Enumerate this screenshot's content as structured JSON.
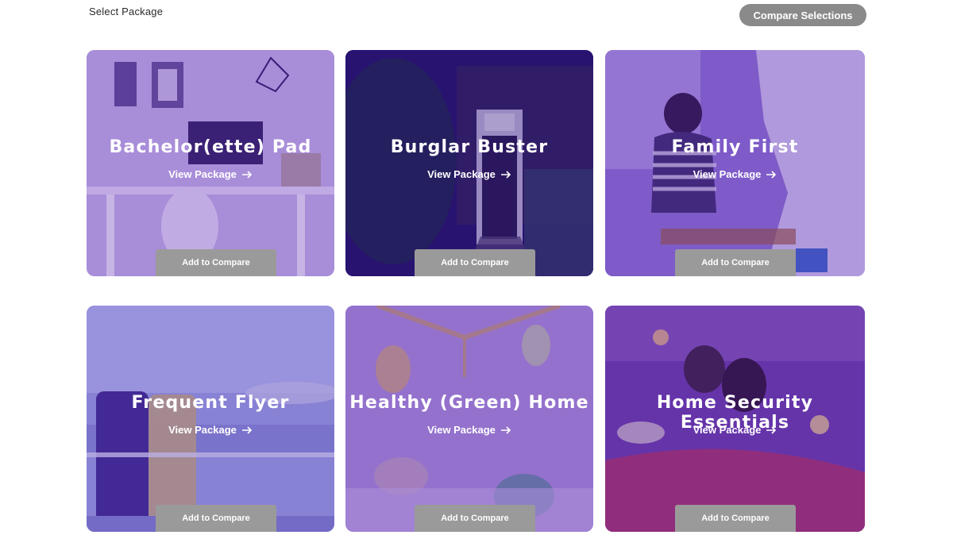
{
  "header": {
    "title": "Select Package",
    "compare_label": "Compare Selections"
  },
  "packages": [
    {
      "title": "Bachelor(ette) Pad",
      "view_label": "View Package",
      "add_label": "Add to Compare"
    },
    {
      "title": "Burglar Buster",
      "view_label": "View Package",
      "add_label": "Add to Compare"
    },
    {
      "title": "Family First",
      "view_label": "View Package",
      "add_label": "Add to Compare"
    },
    {
      "title": "Frequent Flyer",
      "view_label": "View Package",
      "add_label": "Add to Compare"
    },
    {
      "title": "Healthy (Green) Home",
      "view_label": "View Package",
      "add_label": "Add to Compare"
    },
    {
      "title": "Home Security Essentials",
      "view_label": "View Package",
      "add_label": "Add to Compare"
    }
  ],
  "colors": {
    "overlay": "#5a28b4",
    "button_gray": "#8a8a8a",
    "text_white": "#ffffff"
  },
  "icons": {
    "view_link": "arrow-right-icon"
  }
}
